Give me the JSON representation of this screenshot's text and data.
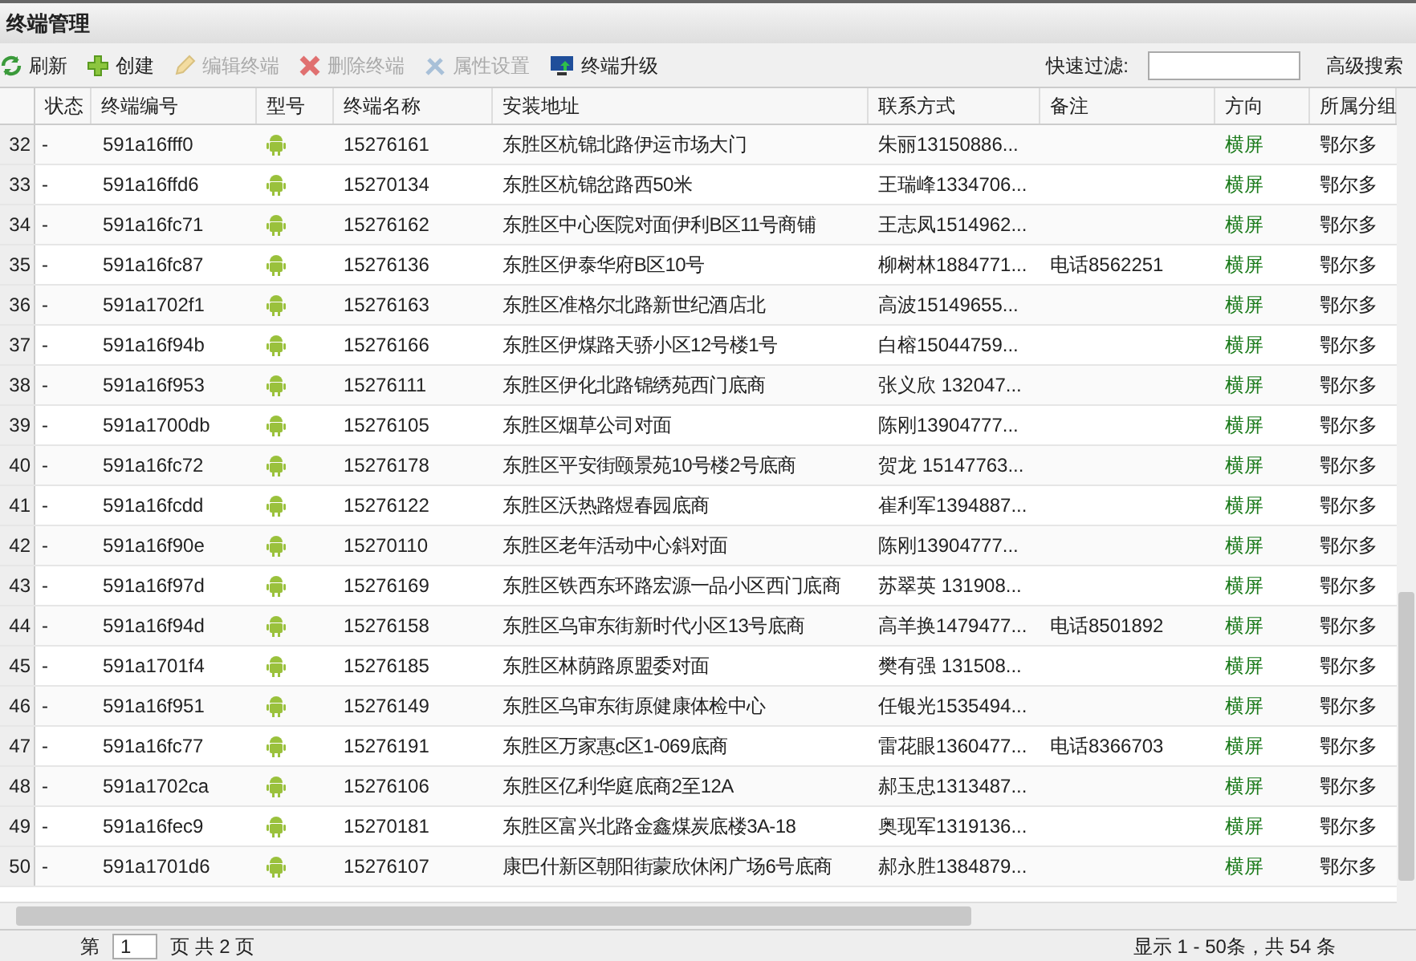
{
  "window": {
    "title": "终端管理"
  },
  "toolbar": [
    {
      "label": "刷新",
      "disabled": false
    },
    {
      "label": "创建",
      "disabled": false
    },
    {
      "label": "编辑终端",
      "disabled": true
    },
    {
      "label": "删除终端",
      "disabled": true
    },
    {
      "label": "属性设置",
      "disabled": true
    },
    {
      "label": "终端升级",
      "disabled": false
    }
  ],
  "filter": {
    "label": "快速过滤:",
    "advanced": "高级搜索"
  },
  "table": {
    "columns": [
      "状态",
      "终端编号",
      "型号",
      "终端名称",
      "安装地址",
      "联系方式",
      "备注",
      "方向",
      "所属分组"
    ],
    "rows": [
      {
        "no": "32",
        "status": "-",
        "id": "591a16fff0",
        "name": "15276161",
        "address": "东胜区杭锦北路伊运市场大门",
        "contact": "朱丽13150886...",
        "note": "",
        "direction": "横屏",
        "group": "鄂尔多"
      },
      {
        "no": "33",
        "status": "-",
        "id": "591a16ffd6",
        "name": "15270134",
        "address": "东胜区杭锦岔路西50米",
        "contact": "王瑞峰1334706...",
        "note": "",
        "direction": "横屏",
        "group": "鄂尔多"
      },
      {
        "no": "34",
        "status": "-",
        "id": "591a16fc71",
        "name": "15276162",
        "address": "东胜区中心医院对面伊利B区11号商铺",
        "contact": "王志凤1514962...",
        "note": "",
        "direction": "横屏",
        "group": "鄂尔多"
      },
      {
        "no": "35",
        "status": "-",
        "id": "591a16fc87",
        "name": "15276136",
        "address": "东胜区伊泰华府B区10号",
        "contact": "柳树林1884771...",
        "note": "电话8562251",
        "direction": "横屏",
        "group": "鄂尔多"
      },
      {
        "no": "36",
        "status": "-",
        "id": "591a1702f1",
        "name": "15276163",
        "address": "东胜区准格尔北路新世纪酒店北",
        "contact": "高波15149655...",
        "note": "",
        "direction": "横屏",
        "group": "鄂尔多"
      },
      {
        "no": "37",
        "status": "-",
        "id": "591a16f94b",
        "name": "15276166",
        "address": "东胜区伊煤路天骄小区12号楼1号",
        "contact": "白榕15044759...",
        "note": "",
        "direction": "横屏",
        "group": "鄂尔多"
      },
      {
        "no": "38",
        "status": "-",
        "id": "591a16f953",
        "name": "15276111",
        "address": "东胜区伊化北路锦绣苑西门底商",
        "contact": "张义欣 132047...",
        "note": "",
        "direction": "横屏",
        "group": "鄂尔多"
      },
      {
        "no": "39",
        "status": "-",
        "id": "591a1700db",
        "name": "15276105",
        "address": "东胜区烟草公司对面",
        "contact": "陈刚13904777...",
        "note": "",
        "direction": "横屏",
        "group": "鄂尔多"
      },
      {
        "no": "40",
        "status": "-",
        "id": "591a16fc72",
        "name": "15276178",
        "address": "东胜区平安街颐景苑10号楼2号底商",
        "contact": "贺龙 15147763...",
        "note": "",
        "direction": "横屏",
        "group": "鄂尔多"
      },
      {
        "no": "41",
        "status": "-",
        "id": "591a16fcdd",
        "name": "15276122",
        "address": "东胜区沃热路煜春园底商",
        "contact": "崔利军1394887...",
        "note": "",
        "direction": "横屏",
        "group": "鄂尔多"
      },
      {
        "no": "42",
        "status": "-",
        "id": "591a16f90e",
        "name": "15270110",
        "address": "东胜区老年活动中心斜对面",
        "contact": "陈刚13904777...",
        "note": "",
        "direction": "横屏",
        "group": "鄂尔多"
      },
      {
        "no": "43",
        "status": "-",
        "id": "591a16f97d",
        "name": "15276169",
        "address": "东胜区铁西东环路宏源一品小区西门底商",
        "contact": "苏翠英 131908...",
        "note": "",
        "direction": "横屏",
        "group": "鄂尔多"
      },
      {
        "no": "44",
        "status": "-",
        "id": "591a16f94d",
        "name": "15276158",
        "address": "东胜区乌审东街新时代小区13号底商",
        "contact": "高羊换1479477...",
        "note": "电话8501892",
        "direction": "横屏",
        "group": "鄂尔多"
      },
      {
        "no": "45",
        "status": "-",
        "id": "591a1701f4",
        "name": "15276185",
        "address": "东胜区林荫路原盟委对面",
        "contact": "樊有强 131508...",
        "note": "",
        "direction": "横屏",
        "group": "鄂尔多"
      },
      {
        "no": "46",
        "status": "-",
        "id": "591a16f951",
        "name": "15276149",
        "address": "东胜区乌审东街原健康体检中心",
        "contact": "任银光1535494...",
        "note": "",
        "direction": "横屏",
        "group": "鄂尔多"
      },
      {
        "no": "47",
        "status": "-",
        "id": "591a16fc77",
        "name": "15276191",
        "address": "东胜区万家惠c区1-069底商",
        "contact": "雷花眼1360477...",
        "note": "电话8366703",
        "direction": "横屏",
        "group": "鄂尔多"
      },
      {
        "no": "48",
        "status": "-",
        "id": "591a1702ca",
        "name": "15276106",
        "address": "东胜区亿利华庭底商2至12A",
        "contact": "郝玉忠1313487...",
        "note": "",
        "direction": "横屏",
        "group": "鄂尔多"
      },
      {
        "no": "49",
        "status": "-",
        "id": "591a16fec9",
        "name": "15270181",
        "address": "东胜区富兴北路金鑫煤炭底楼3A-18",
        "contact": "奥现军1319136...",
        "note": "",
        "direction": "横屏",
        "group": "鄂尔多"
      },
      {
        "no": "50",
        "status": "-",
        "id": "591a1701d6",
        "name": "15276107",
        "address": "康巴什新区朝阳街蒙欣休闲广场6号底商",
        "contact": "郝永胜1384879...",
        "note": "",
        "direction": "横屏",
        "group": "鄂尔多"
      }
    ]
  },
  "pager": {
    "before": "第",
    "page": "1",
    "after": "页 共 2 页",
    "summary": "显示 1 - 50条，共 54 条"
  }
}
